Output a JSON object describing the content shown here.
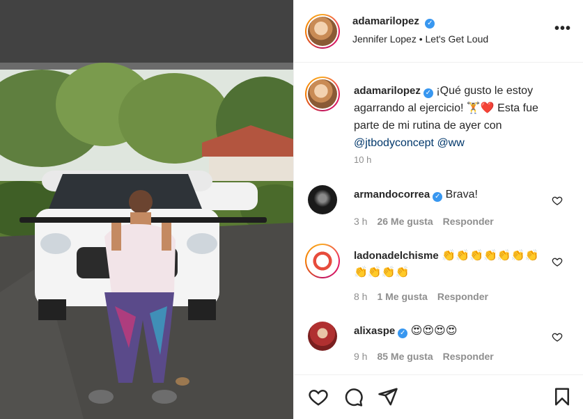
{
  "post": {
    "author": "adamarilopez",
    "audio": "Jennifer Lopez • Let's Get Loud",
    "caption_text": "¡Qué gusto le estoy agarrando al ejercicio! 🏋️❤️ Esta fue parte de mi rutina de ayer con ",
    "caption_mention_1": "@jtbodyconcept",
    "caption_mention_2": "@ww",
    "caption_time": "10 h",
    "more_label": "•••"
  },
  "comments": [
    {
      "user": "armandocorrea",
      "text": "Brava!",
      "time": "3 h",
      "likes": "26 Me gusta",
      "reply": "Responder"
    },
    {
      "user": "ladonadelchisme",
      "text": "👏👏👏👏👏👏👏👏👏👏👏",
      "time": "8 h",
      "likes": "1 Me gusta",
      "reply": "Responder"
    },
    {
      "user": "alixaspe",
      "text": "😍😍😍😍",
      "time": "9 h",
      "likes": "85 Me gusta",
      "reply": "Responder"
    }
  ],
  "icons": {
    "like": "heart-icon",
    "comment": "comment-icon",
    "share": "send-icon",
    "save": "bookmark-icon",
    "verified": "verified-badge-icon",
    "comment_like": "heart-icon"
  },
  "colors": {
    "verified": "#3897f0",
    "mention": "#00376b",
    "muted": "#8e8e8e",
    "text": "#262626"
  }
}
